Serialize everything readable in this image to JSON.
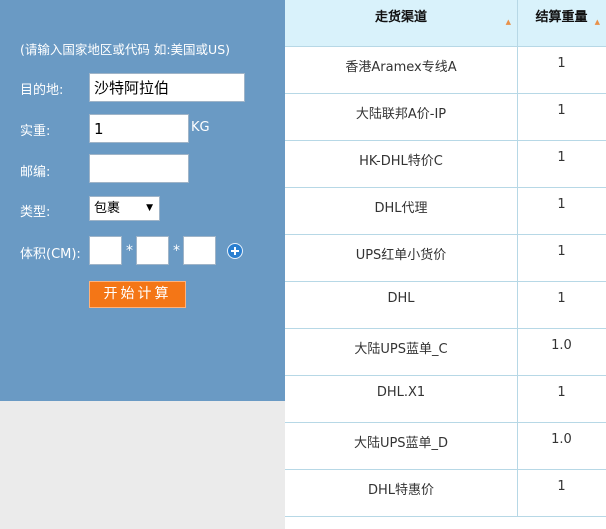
{
  "form": {
    "hint": "(请输入国家地区或代码 如:美国或US)",
    "destination_label": "目的地:",
    "destination_value": "沙特阿拉伯",
    "weight_label": "实重:",
    "weight_value": "1",
    "weight_unit": "KG",
    "postcode_label": "邮编:",
    "postcode_value": "",
    "type_label": "类型:",
    "type_value": "包裹",
    "volume_label": "体积(CM):",
    "volume_sep": "*",
    "dim_length": "",
    "dim_width": "",
    "dim_height": "",
    "submit_label": "开始计算"
  },
  "table": {
    "headers": [
      "走货渠道",
      "结算重量"
    ],
    "rows": [
      {
        "channel": "香港Aramex专线A",
        "weight": "1"
      },
      {
        "channel": "大陆联邦A价-IP",
        "weight": "1"
      },
      {
        "channel": "HK-DHL特价C",
        "weight": "1"
      },
      {
        "channel": "DHL代理",
        "weight": "1"
      },
      {
        "channel": "UPS红单小货价",
        "weight": "1"
      },
      {
        "channel": "DHL",
        "weight": "1"
      },
      {
        "channel": "大陆UPS蓝单_C",
        "weight": "1.0"
      },
      {
        "channel": "DHL.X1",
        "weight": "1"
      },
      {
        "channel": "大陆UPS蓝单_D",
        "weight": "1.0"
      },
      {
        "channel": "DHL特惠价",
        "weight": "1"
      }
    ]
  },
  "colors": {
    "panel": "#6a9ac4",
    "button": "#f47616",
    "table_header": "#d9f2fb",
    "sort_arrow": "#e8914a"
  },
  "icons": {
    "add_dimension": "plus-circle-icon",
    "sort": "sort-up-triangle-icon",
    "dropdown": "dropdown-triangle-icon"
  }
}
